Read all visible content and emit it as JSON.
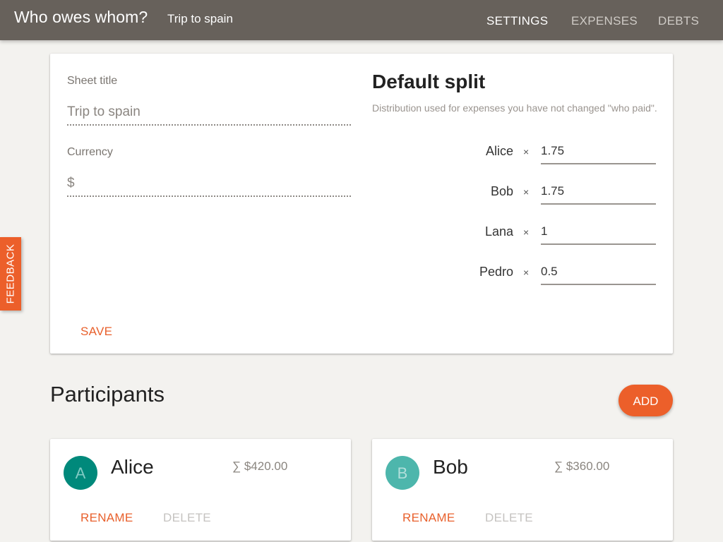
{
  "header": {
    "app_title": "Who owes whom?",
    "sheet_name": "Trip to spain",
    "nav": [
      {
        "label": "SETTINGS",
        "active": true
      },
      {
        "label": "EXPENSES",
        "active": false
      },
      {
        "label": "DEBTS",
        "active": false
      }
    ]
  },
  "feedback": {
    "label": "FEEDBACK"
  },
  "settings": {
    "sheet_title_label": "Sheet title",
    "sheet_title_value": "Trip to spain",
    "currency_label": "Currency",
    "currency_value": "$",
    "save_label": "SAVE",
    "default_split": {
      "title": "Default split",
      "description": "Distribution used for expenses you have not changed \"who paid\".",
      "times_symbol": "×",
      "rows": [
        {
          "name": "Alice",
          "value": "1.75"
        },
        {
          "name": "Bob",
          "value": "1.75"
        },
        {
          "name": "Lana",
          "value": "1"
        },
        {
          "name": "Pedro",
          "value": "0.5"
        }
      ]
    }
  },
  "participants": {
    "title": "Participants",
    "add_label": "ADD",
    "items": [
      {
        "initial": "A",
        "name": "Alice",
        "total": "∑ $420.00",
        "avatar_color": "#00897b",
        "avatar_text_color": "#80cbc4",
        "rename_label": "RENAME",
        "delete_label": "DELETE"
      },
      {
        "initial": "B",
        "name": "Bob",
        "total": "∑ $360.00",
        "avatar_color": "#4db6ac",
        "avatar_text_color": "#b2dfdb",
        "rename_label": "RENAME",
        "delete_label": "DELETE"
      }
    ]
  },
  "colors": {
    "topbar": "#67615b",
    "accent": "#ec5f2a",
    "background": "#f3f2ef"
  }
}
